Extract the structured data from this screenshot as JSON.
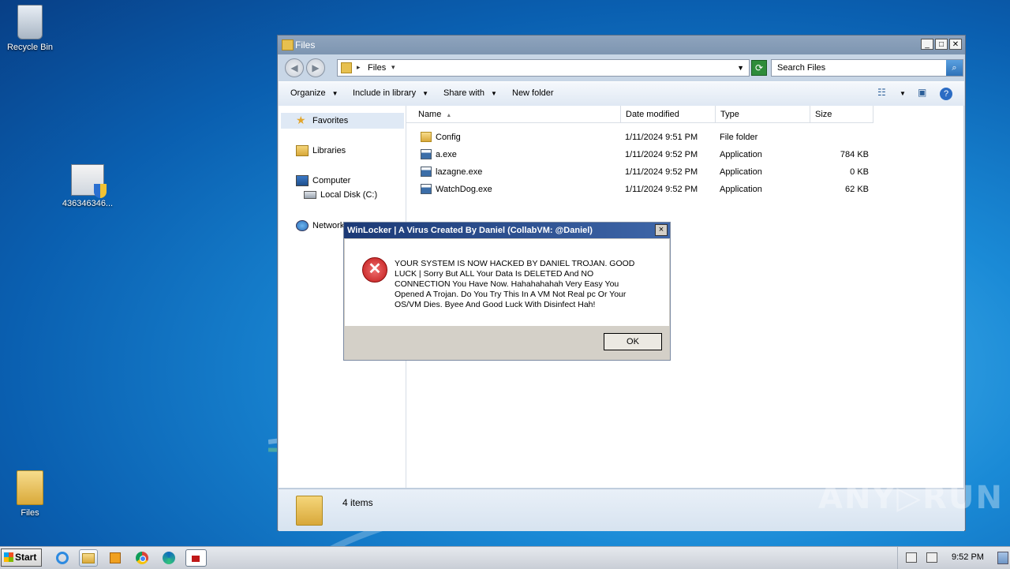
{
  "desktop": {
    "icons": [
      {
        "label": "Recycle Bin"
      },
      {
        "label": "436346346..."
      },
      {
        "label": "Files"
      }
    ]
  },
  "explorer": {
    "title": "Files",
    "address": {
      "crumb": "Files"
    },
    "search_placeholder": "Search Files",
    "toolbar": {
      "organize": "Organize",
      "include": "Include in library",
      "share": "Share with",
      "new_folder": "New folder"
    },
    "nav": {
      "favorites": "Favorites",
      "libraries": "Libraries",
      "computer": "Computer",
      "local_disk": "Local Disk (C:)",
      "network": "Network"
    },
    "columns": {
      "name": "Name",
      "date": "Date modified",
      "type": "Type",
      "size": "Size"
    },
    "files": [
      {
        "name": "Config",
        "date": "1/11/2024 9:51 PM",
        "type": "File folder",
        "size": "",
        "icon": "folder-icon"
      },
      {
        "name": "a.exe",
        "date": "1/11/2024 9:52 PM",
        "type": "Application",
        "size": "784 KB",
        "icon": "application-icon"
      },
      {
        "name": "lazagne.exe",
        "date": "1/11/2024 9:52 PM",
        "type": "Application",
        "size": "0 KB",
        "icon": "application-icon"
      },
      {
        "name": "WatchDog.exe",
        "date": "1/11/2024 9:52 PM",
        "type": "Application",
        "size": "62 KB",
        "icon": "application-icon"
      }
    ],
    "status": {
      "count": "4 items"
    }
  },
  "dialog": {
    "title": "WinLocker | A Virus Created By Daniel (CollabVM: @Daniel)",
    "message": "YOUR SYSTEM IS NOW HACKED BY DANIEL TROJAN. GOOD LUCK | Sorry But ALL Your Data Is DELETED And NO CONNECTION You Have Now. Hahahahahah Very Easy You Opened A Trojan. Do You Try This In A VM Not Real pc Or  Your OS/VM Dies. Byee And Good Luck With Disinfect Hah!",
    "ok": "OK",
    "close": "×"
  },
  "taskbar": {
    "start": "Start",
    "clock": "9:52 PM"
  },
  "watermark": "ANY▷RUN"
}
